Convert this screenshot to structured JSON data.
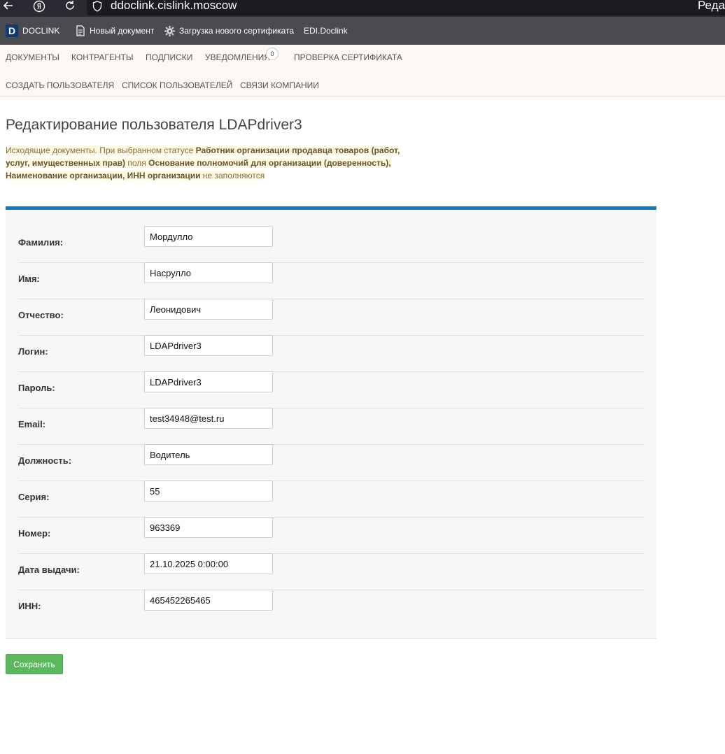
{
  "browser": {
    "url": "ddoclink.cislink.moscow",
    "tab_title_fragment": "Реда",
    "icons": [
      "back-arrow-icon",
      "yandex-icon",
      "reload-icon",
      "shield-icon"
    ]
  },
  "bookmarks": [
    {
      "label": "DOCLINK",
      "icon": "doclink-logo-icon",
      "logo_letter": "D"
    },
    {
      "label": "Новый документ",
      "icon": "document-icon"
    },
    {
      "label": "Загрузка нового сертификата",
      "icon": "gear-icon"
    },
    {
      "label": "EDI.Doclink",
      "icon": ""
    }
  ],
  "nav": {
    "row1": [
      "ДОКУМЕНТЫ",
      "КОНТРАГЕНТЫ",
      "ПОДПИСКИ",
      "УВЕДОМЛЕНИЯ",
      "ПРОВЕРКА СЕРТИФИКАТА"
    ],
    "notifications_count": "0",
    "row2": [
      "СОЗДАТЬ ПОЛЬЗОВАТЕЛЯ",
      "СПИСОК ПОЛЬЗОВАТЕЛЕЙ",
      "СВЯЗИ КОМПАНИИ"
    ]
  },
  "page": {
    "title": "Редактирование пользователя LDAPdriver3",
    "notice": {
      "t1": "Исходящие документы. При выбранном статусе ",
      "b1": "Работник организации продавца товаров (работ, услуг, имущественных прав)",
      "t2": " поля ",
      "b2": "Основание полномочий для организации (доверенность), Наименование организации, ИНН организации",
      "t3": " не заполняются"
    }
  },
  "form": {
    "fields": [
      {
        "label": "Фамилия:",
        "value": "Мордулло"
      },
      {
        "label": "Имя:",
        "value": "Насрулло"
      },
      {
        "label": "Отчество:",
        "value": "Леонидович"
      },
      {
        "label": "Логин:",
        "value": "LDAPdriver3"
      },
      {
        "label": "Пароль:",
        "value": "LDAPdriver3"
      },
      {
        "label": "Email:",
        "value": "test34948@test.ru"
      },
      {
        "label": "Должность:",
        "value": "Водитель"
      },
      {
        "label": "Серия:",
        "value": "55"
      },
      {
        "label": "Номер:",
        "value": "963369"
      },
      {
        "label": "Дата выдачи:",
        "value": "21.10.2025 0:00:00"
      },
      {
        "label": "ИНН:",
        "value": "465452265465"
      }
    ],
    "save_label": "Сохранить"
  },
  "colors": {
    "accent_bar": "#0d7bc7",
    "save_button": "#5cb85c",
    "notice_bg": "#fcf8e3",
    "notice_text": "#8a6d3b"
  }
}
